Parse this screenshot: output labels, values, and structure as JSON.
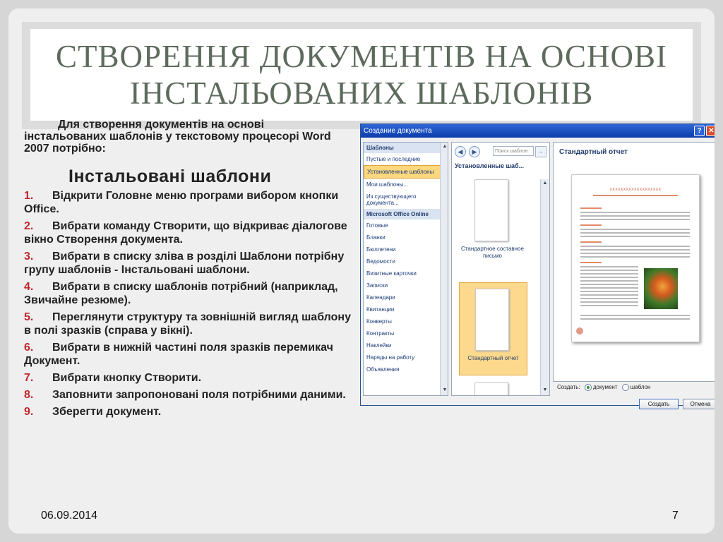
{
  "slide": {
    "title": "СТВОРЕННЯ ДОКУМЕНТІВ НА ОСНОВІ ІНСТАЛЬОВАНИХ ШАБЛОНІВ",
    "intro": "Для створення документів на основі інстальованих шаблонів у текстовому процесорі Word 2007 потрібно:",
    "subhead": "Інстальовані шаблони",
    "steps": [
      {
        "num": "1.",
        "text": "Відкрити Головне меню програми вибором кнопки Office."
      },
      {
        "num": "2.",
        "text": "Вибрати команду Створити, що відкриває діалогове вікно Створення документа."
      },
      {
        "num": "3.",
        "text": "Вибрати в списку зліва в розділі Шаблони потрібну групу шаблонів - Інстальовані шаблони."
      },
      {
        "num": "4.",
        "text": "Вибрати в списку шаблонів потрібний (наприклад, Звичайне резюме)."
      },
      {
        "num": "5.",
        "text": "Переглянути структуру та зовнішній вигляд шаблону в полі зразків (справа у вікні)."
      },
      {
        "num": "6.",
        "text": "Вибрати в нижній частині поля зразків перемикач Документ."
      },
      {
        "num": "7.",
        "text": "Вибрати кнопку Створити."
      },
      {
        "num": "8.",
        "text": "Заповнити запропоновані поля потрібними даними."
      },
      {
        "num": "9.",
        "text": "Зберегти документ."
      }
    ],
    "date": "06.09.2014",
    "page_number": "7"
  },
  "dialog": {
    "title": "Создание документа",
    "help_label": "?",
    "close_label": "✕",
    "left_panel": {
      "templates_header": "Шаблоны",
      "items_top": [
        "Пустые и последние",
        "Установленные шаблоны",
        "Мои шаблоны...",
        "Из существующего документа..."
      ],
      "online_header": "Microsoft Office Online",
      "items_online": [
        "Готовые",
        "Бланки",
        "Бюллетени",
        "Ведомости",
        "Визитные карточки",
        "Записки",
        "Календари",
        "Квитанции",
        "Конверты",
        "Контракты",
        "Наклейки",
        "Наряды на работу",
        "Объявления"
      ]
    },
    "middle_panel": {
      "search_placeholder": "Поиск шаблон",
      "header": "Установленные шаб...",
      "thumbs": [
        "Стандартное составное письмо",
        "Стандартный отчет"
      ]
    },
    "preview": {
      "title": "Стандартный отчет",
      "banner": "XXXXXXXXXXXXXXXXXXX"
    },
    "create_label": "Создать:",
    "radio_document": "документ",
    "radio_template": "шаблон",
    "btn_create": "Создать",
    "btn_cancel": "Отмена"
  }
}
